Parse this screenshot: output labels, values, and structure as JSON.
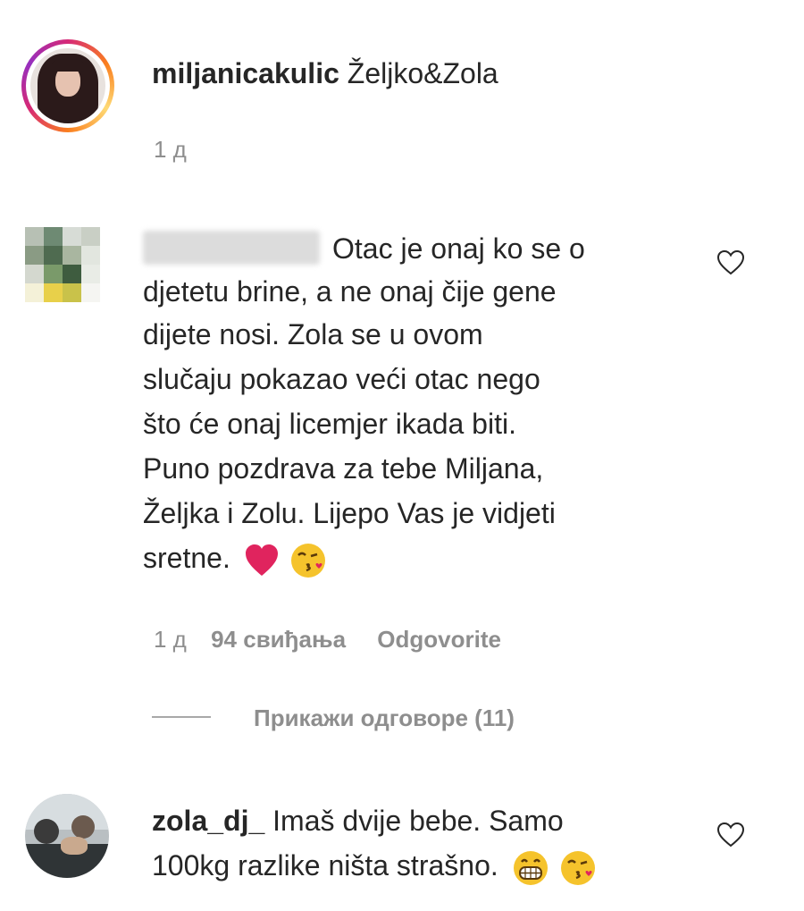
{
  "post": {
    "username": "miljanicakulic",
    "caption": "Željko&Zola",
    "time": "1 д"
  },
  "comment1": {
    "username_hidden": "",
    "text_lines": [
      "Otac je onaj ko se o",
      "djetetu brine, a ne onaj čije gene",
      "dijete nosi. Zola se u ovom",
      "slučaju pokazao veći otac nego",
      "što će onaj licemjer ikada biti.",
      "Puno pozdrava za tebe Miljana,",
      "Željka i Zolu. Lijepo Vas je vidjeti",
      "sretne."
    ],
    "time": "1 д",
    "likes": "94 свиђања",
    "reply_label": "Odgovorite",
    "view_replies": "Прикажи одговоре (11)"
  },
  "comment2": {
    "username": "zola_dj_",
    "text_line1": "Imaš dvije bebe. Samo",
    "text_line2": "100kg razlike ništa strašno."
  },
  "icons": {
    "like_icon": "heart-outline-icon",
    "emoji_heart": "red-heart",
    "emoji_kiss": "face-blowing-kiss",
    "emoji_grin": "grinning-face"
  },
  "colors": {
    "text": "#262626",
    "muted": "#8e8e8e",
    "heart_red": "#e0245e",
    "emoji_yellow": "#f5c32c"
  }
}
